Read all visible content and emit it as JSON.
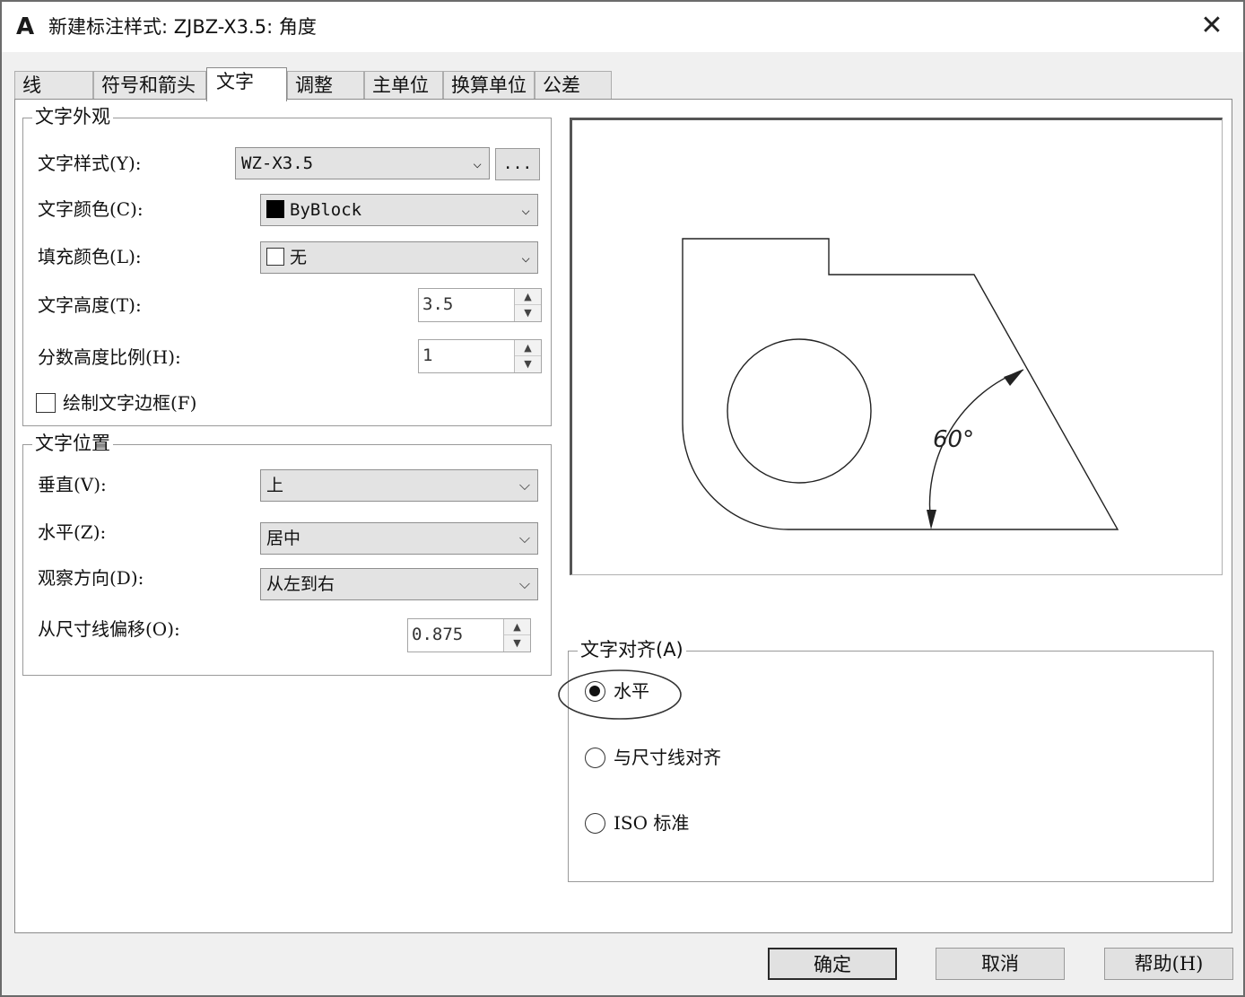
{
  "window": {
    "title": "新建标注样式: ZJBZ-X3.5: 角度",
    "app_icon": "A",
    "close_glyph": "✕"
  },
  "tabs": [
    {
      "label": "线"
    },
    {
      "label": "符号和箭头"
    },
    {
      "label": "文字"
    },
    {
      "label": "调整"
    },
    {
      "label": "主单位"
    },
    {
      "label": "换算单位"
    },
    {
      "label": "公差"
    }
  ],
  "text_appearance": {
    "group_label": "文字外观",
    "text_style_label": "文字样式(Y):",
    "text_style_value": "WZ-X3.5",
    "browse_label": "...",
    "text_color_label": "文字颜色(C):",
    "text_color_value": "ByBlock",
    "fill_color_label": "填充颜色(L):",
    "fill_color_value": "无",
    "text_height_label": "文字高度(T):",
    "text_height_value": "3.5",
    "fraction_scale_label": "分数高度比例(H):",
    "fraction_scale_value": "1",
    "draw_frame_label": "绘制文字边框(F)",
    "draw_frame_checked": false
  },
  "text_placement": {
    "group_label": "文字位置",
    "vertical_label": "垂直(V):",
    "vertical_value": "上",
    "horizontal_label": "水平(Z):",
    "horizontal_value": "居中",
    "view_direction_label": "观察方向(D):",
    "view_direction_value": "从左到右",
    "offset_label": "从尺寸线偏移(O):",
    "offset_value": "0.875"
  },
  "preview": {
    "angle_text": "60°"
  },
  "text_alignment": {
    "group_label": "文字对齐(A)",
    "options": [
      {
        "label": "水平",
        "selected": true
      },
      {
        "label": "与尺寸线对齐",
        "selected": false
      },
      {
        "label": "ISO 标准",
        "selected": false
      }
    ]
  },
  "footer": {
    "ok_label": "确定",
    "cancel_label": "取消",
    "help_label": "帮助(H)"
  },
  "icons": {
    "dropdown": "chevron-down-icon",
    "spin_up": "triangle-up-icon",
    "spin_down": "triangle-down-icon"
  },
  "colors": {
    "byblock_swatch": "#000000",
    "none_swatch": "#ffffff"
  }
}
